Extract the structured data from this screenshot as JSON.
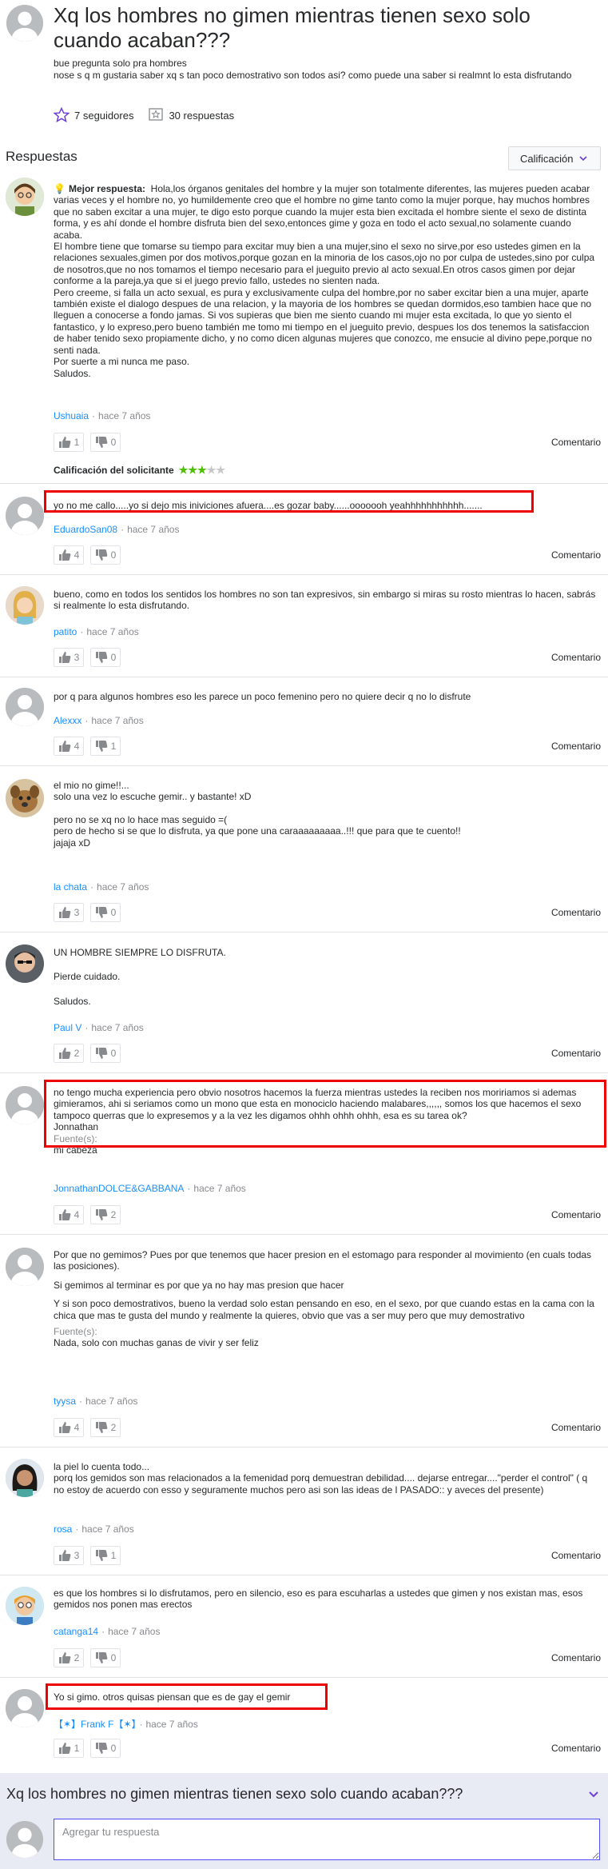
{
  "question": {
    "title": "Xq los hombres no gimen mientras tienen sexo solo cuando acaban???",
    "body_lines": [
      "bue pregunta solo pra hombres",
      "nose s q m gustaria saber xq s tan poco demostrativo son todos asi? como puede una saber si realmnt lo esta disfrutando"
    ],
    "followers_label": "7 seguidores",
    "answers_count_label": "30 respuestas"
  },
  "answers_heading": "Respuestas",
  "sort_label": "Calificación",
  "best_answer_label": "Mejor respuesta:",
  "asker_rating_label": "Calificación del solicitante",
  "asker_rating_value": 3,
  "asker_rating_max": 5,
  "comment_label": "Comentario",
  "source_label": "Fuente(s):",
  "answers": [
    {
      "author": "Ushuaia",
      "time": "hace 7 años",
      "up": "1",
      "down": "0",
      "best": true,
      "paragraphs": [
        "Hola,los órganos genitales del hombre y la mujer son totalmente diferentes, las mujeres pueden acabar varias veces y el hombre no, yo humildemente creo que el hombre no gime tanto como la mujer porque, hay muchos hombres que no saben excitar a una mujer, te digo esto porque cuando la mujer esta bien excitada el hombre siente el sexo de distinta forma, y es ahí donde el hombre disfruta bien del sexo,entonces gime y goza en todo el acto sexual,no solamente cuando acaba.\nEl hombre tiene que tomarse su tiempo para excitar muy bien a una mujer,sino el sexo no sirve,por eso ustedes gimen en la relaciones sexuales,gimen por dos motivos,porque gozan en la minoria de los casos,ojo no por culpa de ustedes,sino por culpa de nosotros,que no nos tomamos el tiempo necesario para el jueguito previo al acto sexual.En otros casos gimen por dejar conforme a la pareja,ya que si el juego previo fallo, ustedes no sienten nada.\nPero creeme, si falla un acto sexual, es pura y exclusivamente culpa del hombre,por no saber excitar bien a una mujer, aparte también existe el dialogo despues de una relacion, y la mayoria de los hombres se quedan dormidos,eso tambien hace que no lleguen a conocerse a fondo jamas. Si vos supieras que bien me siento cuando mi mujer esta excitada, lo que yo siento el fantastico, y lo expreso,pero bueno también me tomo mi tiempo en el jueguito previo, despues los dos tenemos la satisfaccion de haber tenido sexo propiamente dicho, y no como dicen algunas mujeres que conozco, me ensucie al divino pepe,porque no senti nada.\nPor suerte a mi nunca me paso.\nSaludos."
      ]
    },
    {
      "author": "EduardoSan08",
      "time": "hace 7 años",
      "up": "4",
      "down": "0",
      "paragraphs": [
        "yo no me callo.....yo si dejo mis iniviciones afuera....es gozar baby......ooooooh yeahhhhhhhhhhh......."
      ]
    },
    {
      "author": "patito",
      "time": "hace 7 años",
      "up": "3",
      "down": "0",
      "paragraphs": [
        "bueno, como en todos los sentidos los hombres no son tan expresivos, sin embargo si miras su rosto mientras lo hacen, sabrás si realmente lo esta disfrutando."
      ]
    },
    {
      "author": "Alexxx",
      "time": "hace 7 años",
      "up": "4",
      "down": "1",
      "paragraphs": [
        "por q para algunos hombres eso les parece un poco femenino pero no quiere decir q no lo disfrute"
      ]
    },
    {
      "author": "la chata",
      "time": "hace 7 años",
      "up": "3",
      "down": "0",
      "paragraphs": [
        "el mio no gime!!...\nsolo una vez lo escuche gemir.. y bastante! xD",
        "",
        "pero no se xq no lo hace mas seguido =(\npero de hecho si se que lo disfruta, ya que pone una caraaaaaaaaa..!!! que para que te cuento!!\njajaja xD"
      ]
    },
    {
      "author": "Paul V",
      "time": "hace 7 años",
      "up": "2",
      "down": "0",
      "paragraphs": [
        "UN HOMBRE SIEMPRE LO DISFRUTA.",
        "Pierde cuidado.",
        "Saludos."
      ]
    },
    {
      "author": "JonnathanDOLCE&GABBANA",
      "time": "hace 7 años",
      "up": "4",
      "down": "2",
      "paragraphs": [
        "no tengo mucha experiencia pero obvio nosotros hacemos la fuerza mientras ustedes la reciben nos moririamos si ademas gimieramos, ahi si seriamos como un mono que esta en monociclo haciendo malabares,,,,,, somos los que hacemos el sexo tampoco querras que lo expresemos y a la vez les digamos ohhh ohhh ohhh, esa es su tarea ok?\nJonnathan"
      ],
      "source": "mi cabeza"
    },
    {
      "author": "tyysa",
      "time": "hace 7 años",
      "up": "4",
      "down": "2",
      "paragraphs": [
        "Por que no gemimos? Pues por que tenemos que hacer presion en el estomago para responder al movimiento (en cuals todas las posiciones).",
        "Si gemimos al terminar es por que ya no hay mas presion que hacer",
        "Y si son poco demostrativos, bueno la verdad solo estan pensando en eso, en el sexo, por que cuando estas en la cama con la chica que mas te gusta del mundo y realmente la quieres, obvio que vas a ser muy pero que muy demostrativo"
      ],
      "source": "Nada, solo con muchas ganas de vivir y ser feliz"
    },
    {
      "author": "rosa",
      "time": "hace 7 años",
      "up": "3",
      "down": "1",
      "paragraphs": [
        "la piel lo cuenta todo...\nporq los gemidos son mas relacionados a la femenidad porq demuestran debilidad.... dejarse entregar....\"perder el control\" ( q no estoy de acuerdo con esso y seguramente muchos pero asi son las ideas de l PASADO:: y aveces del presente)"
      ]
    },
    {
      "author": "catanga14",
      "time": "hace 7 años",
      "up": "2",
      "down": "0",
      "paragraphs": [
        "es que los hombres si lo disfrutamos, pero en silencio, eso es para escuharlas a ustedes que gimen y nos existan mas, esos gemidos nos ponen mas erectos"
      ]
    },
    {
      "author": "【✶】Frank F【✶】",
      "time": "hace 7 años",
      "up": "1",
      "down": "0",
      "paragraphs": [
        "Yo si gimo. otros quisas piensan que es de gay el gemir"
      ]
    }
  ],
  "bottom": {
    "title": "Xq los hombres no gimen mientras tienen sexo solo cuando acaban???",
    "input_placeholder": "Agregar tu respuesta"
  },
  "colors": {
    "link": "#188fff",
    "highlight_box": "#e00000",
    "rating_star": "#4ec000",
    "input_border": "#4d4cff",
    "bottom_bar": "#e8eaf4"
  }
}
